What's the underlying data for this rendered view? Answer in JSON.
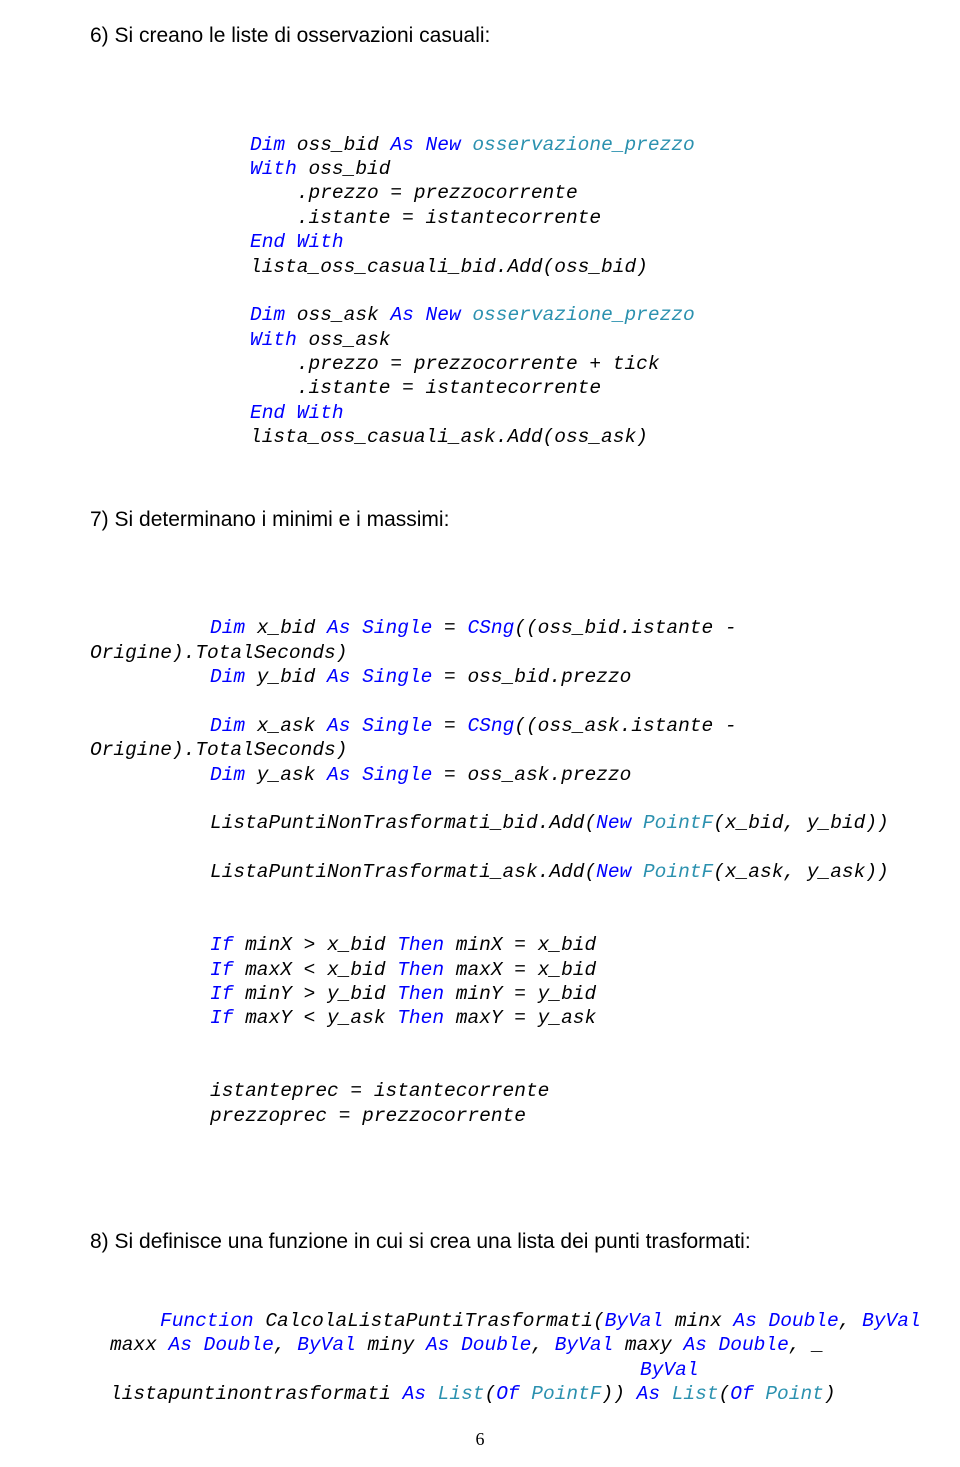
{
  "headings": {
    "h6": "6) Si creano le liste di osservazioni casuali:",
    "h7": "7) Si determinano i minimi e i massimi:",
    "h8": "8) Si definisce una funzione in cui si crea una lista dei punti trasformati:"
  },
  "code6": {
    "l1_kw": "Dim",
    "l1_mid": " oss_bid ",
    "l1_as": "As",
    "l1_new": " New ",
    "l1_type": "osservazione_prezzo",
    "l2_with": "With",
    "l2_rest": " oss_bid",
    "l3": "    .prezzo = prezzocorrente",
    "l4": "    .istante = istantecorrente",
    "l5_end": "End",
    "l5_with": " With",
    "l6": "lista_oss_casuali_bid.Add(oss_bid)",
    "l7_kw": "Dim",
    "l7_mid": " oss_ask ",
    "l7_as": "As",
    "l7_new": " New ",
    "l7_type": "osservazione_prezzo",
    "l8_with": "With",
    "l8_rest": " oss_ask",
    "l9": "    .prezzo = prezzocorrente + tick",
    "l10": "    .istante = istantecorrente",
    "l11_end": "End",
    "l11_with": " With",
    "l12": "lista_oss_casuali_ask.Add(oss_ask)"
  },
  "code7": {
    "a1_dim": "Dim",
    "a1_mid": " x_bid ",
    "a1_as": "As",
    "a1_sng": " Single",
    "a1_eq": " = ",
    "a1_csng": "CSng",
    "a1_rest": "((oss_bid.istante -",
    "a2": "Origine).TotalSeconds)",
    "a3_dim": "Dim",
    "a3_mid": " y_bid ",
    "a3_as": "As",
    "a3_sng": " Single",
    "a3_rest": " = oss_bid.prezzo",
    "b1_dim": "Dim",
    "b1_mid": " x_ask ",
    "b1_as": "As",
    "b1_sng": " Single",
    "b1_eq": " = ",
    "b1_csng": "CSng",
    "b1_rest": "((oss_ask.istante -",
    "b2": "Origine).TotalSeconds)",
    "b3_dim": "Dim",
    "b3_mid": " y_ask ",
    "b3_as": "As",
    "b3_sng": " Single",
    "b3_rest": " = oss_ask.prezzo",
    "c1_pre": "ListaPuntiNonTrasformati_bid.Add(",
    "c1_new": "New",
    "c1_pf": " PointF",
    "c1_post": "(x_bid, y_bid))",
    "c2_pre": "ListaPuntiNonTrasformati_ask.Add(",
    "c2_new": "New",
    "c2_pf": " PointF",
    "c2_post": "(x_ask, y_ask))",
    "d1_if": "If",
    "d1_mid": " minX > x_bid ",
    "d1_then": "Then",
    "d1_rest": " minX = x_bid",
    "d2_if": "If",
    "d2_mid": " maxX < x_bid ",
    "d2_then": "Then",
    "d2_rest": " maxX = x_bid",
    "d3_if": "If",
    "d3_mid": " minY > y_bid ",
    "d3_then": "Then",
    "d3_rest": " minY = y_bid",
    "d4_if": "If",
    "d4_mid": " maxY < y_ask ",
    "d4_then": "Then",
    "d4_rest": " maxY = y_ask",
    "e1": "istanteprec = istantecorrente",
    "e2": "prezzoprec = prezzocorrente"
  },
  "code8": {
    "l1_fn": "Function",
    "l1_name": " CalcolaListaPuntiTrasformati(",
    "l1_bv1": "ByVal",
    "l1_mid": " minx ",
    "l1_as": "As",
    "l1_dbl": " Double",
    "l1_c": ", ",
    "l1_bv2": "ByVal",
    "l2_pre": "maxx ",
    "l2_as": "As",
    "l2_dbl": " Double",
    "l2_c": ", ",
    "l2_bv": "ByVal",
    "l2_mid2": " miny ",
    "l2_as2": "As",
    "l2_dbl2": " Double",
    "l2_c2": ", ",
    "l2_bv2": "ByVal",
    "l2_mid3": " maxy ",
    "l2_as3": "As",
    "l2_dbl3": " Double",
    "l2_end": ", _",
    "l3_bv": "ByVal",
    "l4_pre": "listapuntinontrasformati ",
    "l4_as": "As",
    "l4_sp": " ",
    "l4_list": "List",
    "l4_o": "(",
    "l4_of": "Of",
    "l4_pf": " PointF",
    "l4_c": ")) ",
    "l4_as2": "As",
    "l4_sp2": " ",
    "l4_list2": "List",
    "l4_o2": "(",
    "l4_of2": "Of",
    "l4_pt": " Point",
    "l4_c2": ")"
  },
  "page_number": "6"
}
